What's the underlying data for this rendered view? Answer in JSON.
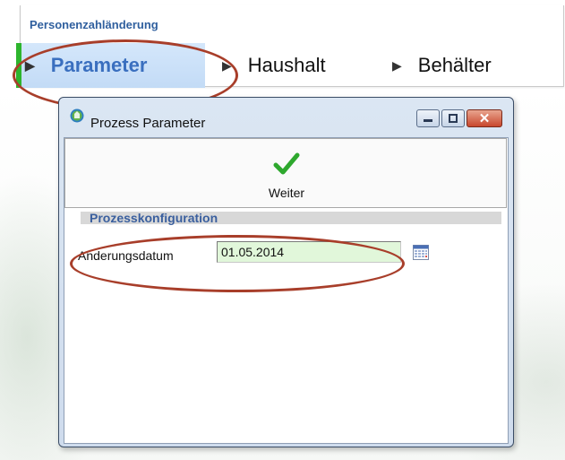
{
  "wizard": {
    "title": "Personenzahländerung",
    "steps": [
      {
        "label": "Parameter",
        "active": true
      },
      {
        "label": "Haushalt",
        "active": false
      },
      {
        "label": "Behälter",
        "active": false
      }
    ]
  },
  "dialog": {
    "title": "Prozess Parameter",
    "toolbar": {
      "weiter_label": "Weiter"
    },
    "section_title": "Prozesskonfiguration",
    "fields": {
      "aenderungsdatum_label": "Anderungsdatum",
      "aenderungsdatum_value": "01.05.2014"
    }
  },
  "colors": {
    "accent_blue": "#3a6fbf",
    "step_marker_green": "#2db52d",
    "annotation_red": "#a83e2a",
    "input_bg": "#e1f7da",
    "check_green": "#2ea82e"
  }
}
